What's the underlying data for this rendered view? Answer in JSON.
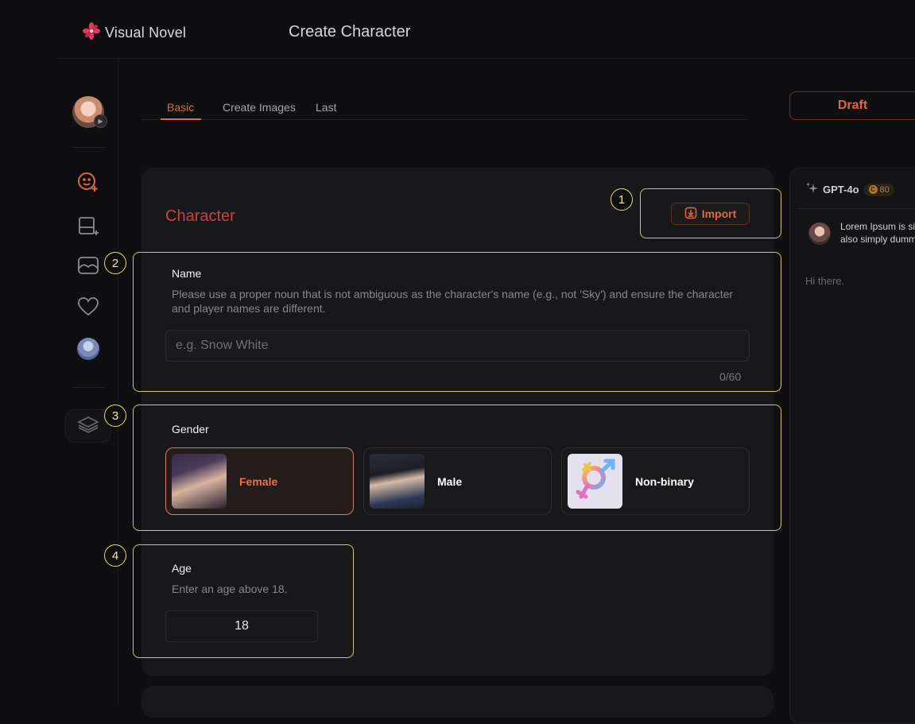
{
  "app": {
    "brand": "Visual Novel",
    "page_title": "Create Character"
  },
  "tabs": [
    {
      "label": "Basic",
      "active": true
    },
    {
      "label": "Create Images",
      "active": false
    },
    {
      "label": "Last",
      "active": false
    }
  ],
  "draft_label": "Draft",
  "character": {
    "section_title": "Character",
    "import_label": "Import",
    "step_numbers": [
      "1",
      "2",
      "3",
      "4"
    ],
    "name": {
      "label": "Name",
      "hint_line1": "Please use a proper noun that is not ambiguous as the character's name (e.g., not 'Sky') and ensure the character",
      "hint_line2": "and player names are different.",
      "placeholder": "e.g. Snow White",
      "counter": "0/60"
    },
    "gender": {
      "label": "Gender",
      "options": [
        {
          "label": "Female",
          "selected": true
        },
        {
          "label": "Male",
          "selected": false
        },
        {
          "label": "Non-binary",
          "selected": false
        }
      ]
    },
    "age": {
      "label": "Age",
      "hint": "Enter an age above 18.",
      "value": "18"
    }
  },
  "chat": {
    "model": "GPT-4o",
    "credits": "80",
    "message": "Lorem Ipsum is simply dummy text",
    "message_line2": "also simply dummy",
    "greeting": "Hi there."
  },
  "colors": {
    "accent": "#e0673f",
    "highlight": "#cdc76a",
    "background": "#0f0f11"
  }
}
